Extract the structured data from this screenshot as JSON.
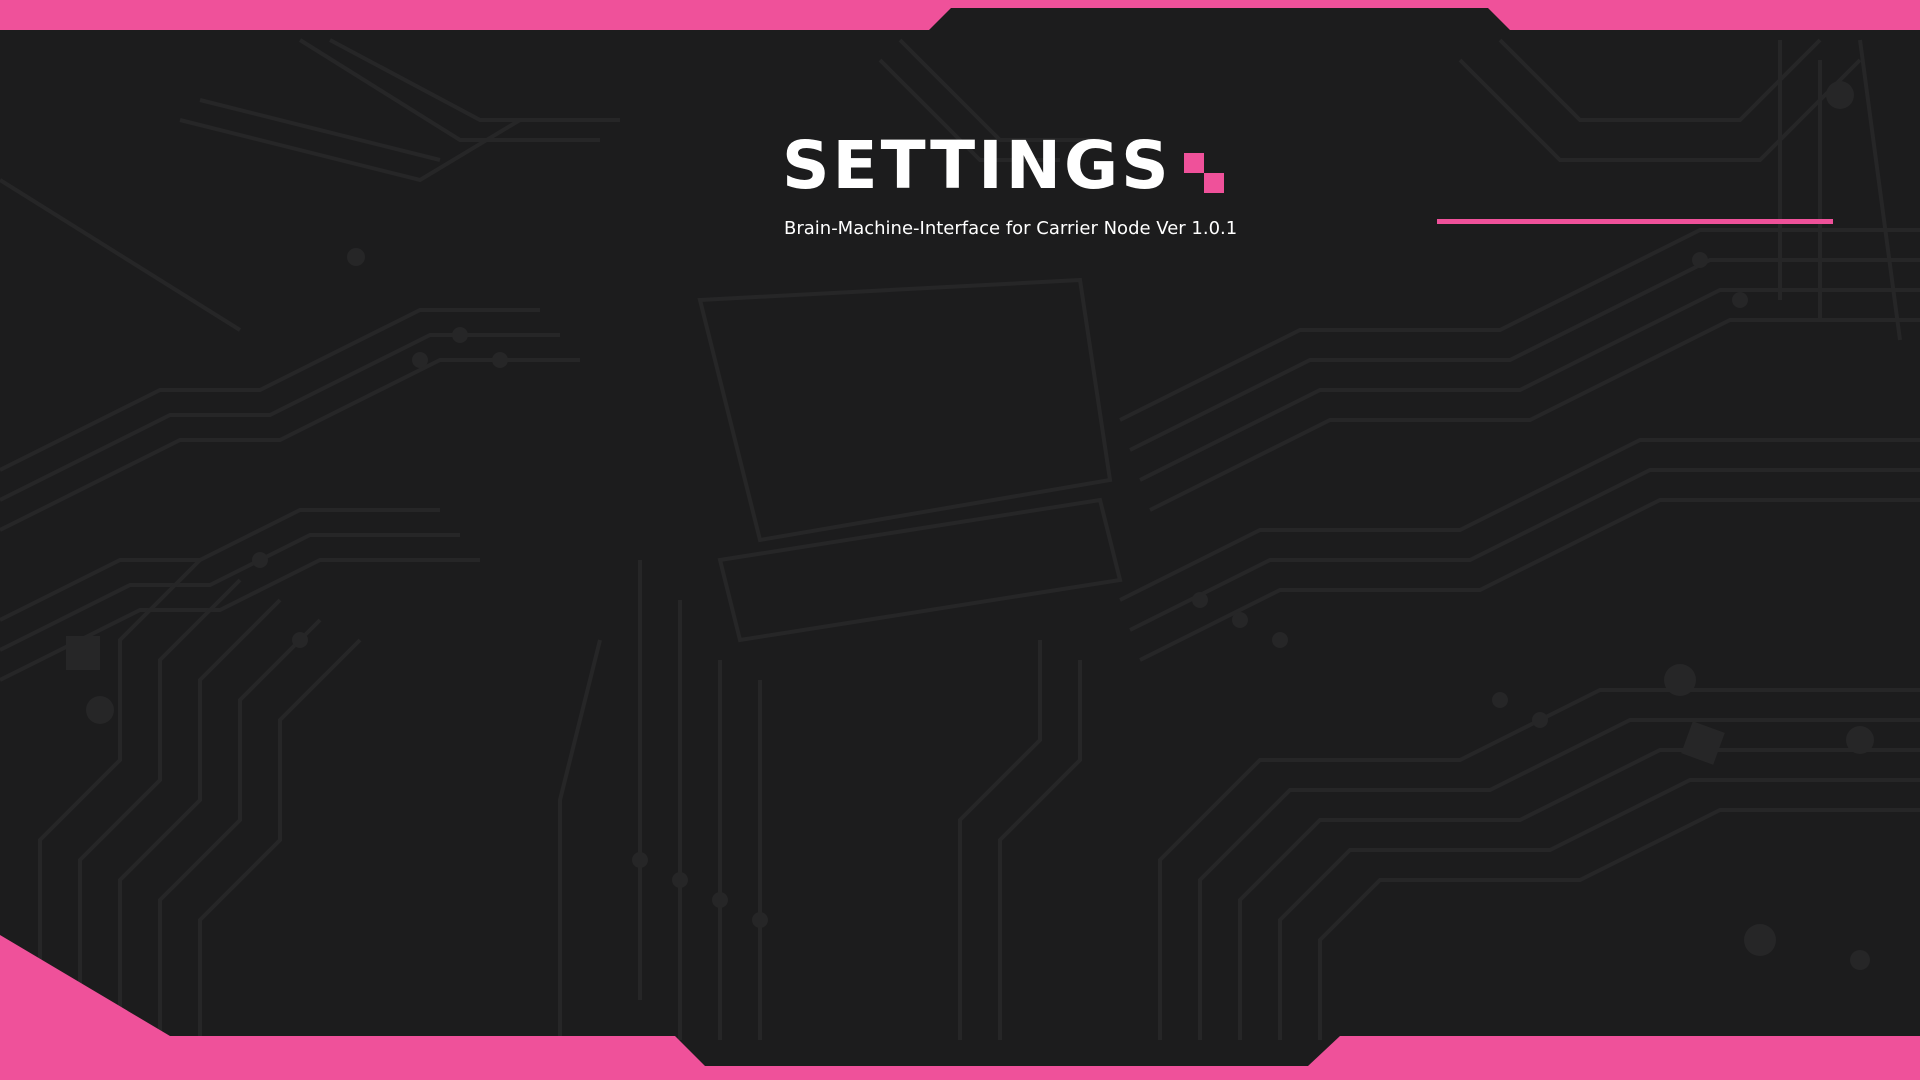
{
  "header": {
    "title": "SETTINGS",
    "subtitle": "Brain-Machine-Interface for Carrier Node Ver 1.0.1"
  },
  "colors": {
    "accent": "#ef519a",
    "background": "#1c1c1d",
    "circuit": "#262627",
    "text": "#ffffff"
  },
  "icons": {
    "title_mark": "pixel-squares-icon"
  }
}
